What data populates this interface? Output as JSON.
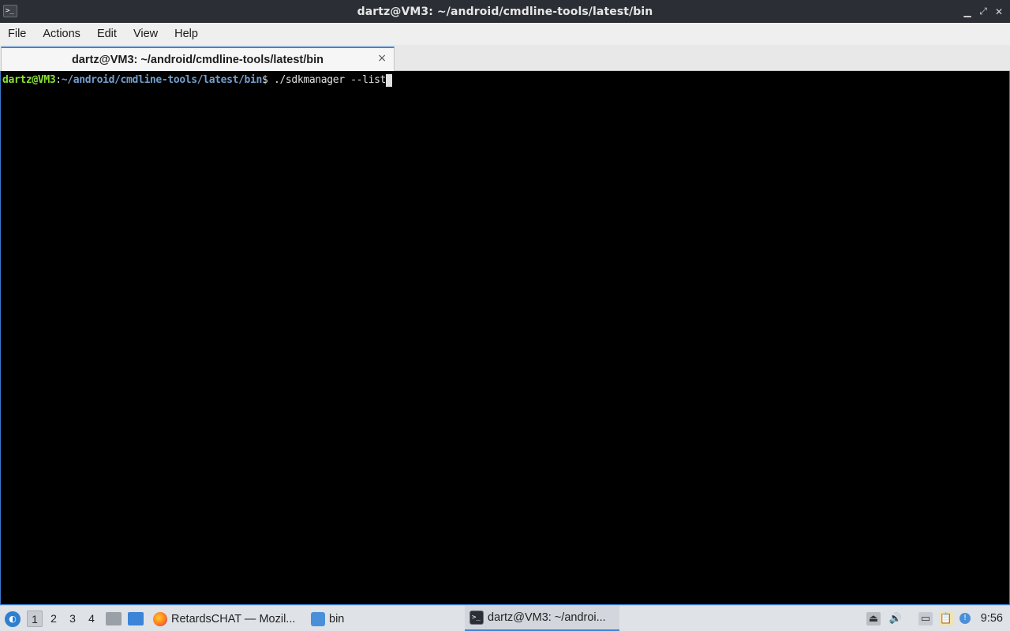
{
  "window": {
    "title": "dartz@VM3: ~/android/cmdline-tools/latest/bin"
  },
  "menu": [
    "File",
    "Actions",
    "Edit",
    "View",
    "Help"
  ],
  "tab": {
    "label": "dartz@VM3: ~/android/cmdline-tools/latest/bin",
    "close": "×"
  },
  "terminal": {
    "user_host": "dartz@VM3",
    "colon": ":",
    "path": "~/android/cmdline-tools/latest/bin",
    "prompt_symbol": "$ ",
    "command": "./sdkmanager --list",
    "colors": {
      "user": "#8ae234",
      "path": "#729fcf",
      "text": "#e0e0e0",
      "background": "#000000"
    }
  },
  "taskbar": {
    "desktops": [
      "1",
      "2",
      "3",
      "4"
    ],
    "active_desktop": "1",
    "tasks": [
      {
        "label": "RetardsCHAT — Mozil...",
        "icon": "firefox-icon"
      },
      {
        "label": "bin",
        "icon": "folder-icon"
      },
      {
        "label": "dartz@VM3: ~/androi...",
        "icon": "terminal-icon"
      }
    ],
    "clock": "9:56"
  }
}
